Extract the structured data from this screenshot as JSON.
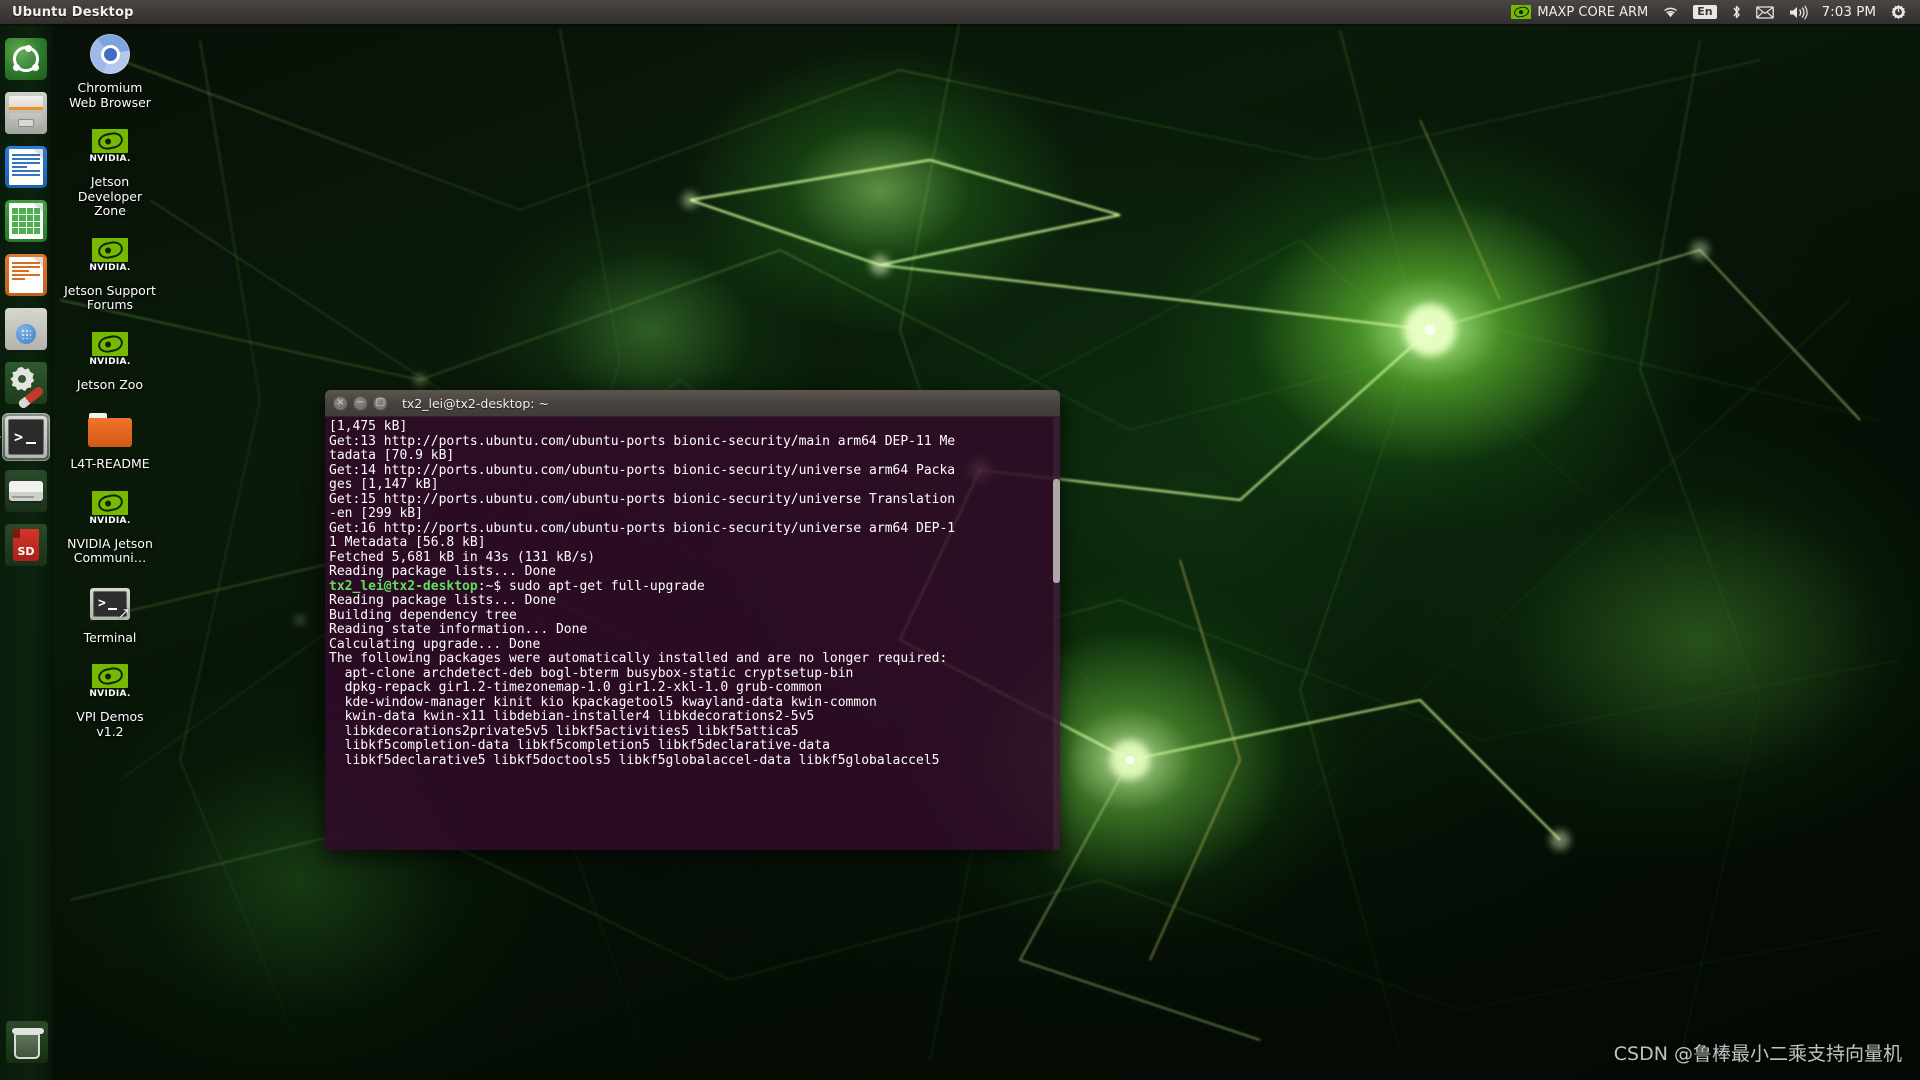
{
  "panel": {
    "title": "Ubuntu Desktop",
    "indicators": {
      "nvidia_logo": "nvidia-logo-icon",
      "nvidia_label": "MAXP CORE ARM",
      "wifi": "wifi-icon",
      "keyboard": "En",
      "bluetooth": "bluetooth-icon",
      "mail": "mail-icon",
      "volume": "volume-icon",
      "time": "7:03 PM",
      "session": "power-gear-icon"
    }
  },
  "launcher": {
    "items": [
      {
        "name": "ubuntu-dash",
        "label": "Ubuntu Dash",
        "icon": "ubuntu-logo-icon"
      },
      {
        "name": "files",
        "label": "Files",
        "icon": "file-cabinet-icon"
      },
      {
        "name": "libreoffice-writer",
        "label": "LibreOffice Writer",
        "icon": "document-icon"
      },
      {
        "name": "libreoffice-calc",
        "label": "LibreOffice Calc",
        "icon": "spreadsheet-icon"
      },
      {
        "name": "libreoffice-impress",
        "label": "LibreOffice Impress",
        "icon": "presentation-icon"
      },
      {
        "name": "ubuntu-software",
        "label": "Ubuntu Software",
        "icon": "shopping-bag-icon"
      },
      {
        "name": "system-settings",
        "label": "System Settings",
        "icon": "gear-wrench-icon"
      },
      {
        "name": "terminal",
        "label": "Terminal",
        "icon": "terminal-icon",
        "running": true
      },
      {
        "name": "disk-drive",
        "label": "Disk Drive",
        "icon": "hard-drive-icon"
      },
      {
        "name": "sd-card",
        "label": "SD Card",
        "icon": "sd-card-icon",
        "badge": "SD"
      },
      {
        "name": "trash",
        "label": "Trash",
        "icon": "trash-icon"
      }
    ]
  },
  "desktop": {
    "icons": [
      {
        "name": "chromium-web-browser",
        "label": "Chromium Web Browser",
        "icon": "chromium-icon"
      },
      {
        "name": "jetson-developer-zone",
        "label": "Jetson Developer Zone",
        "icon": "nvidia-icon",
        "brand": "NVIDIA."
      },
      {
        "name": "jetson-support-forums",
        "label": "Jetson Support Forums",
        "icon": "nvidia-icon",
        "brand": "NVIDIA."
      },
      {
        "name": "jetson-zoo",
        "label": "Jetson Zoo",
        "icon": "nvidia-icon",
        "brand": "NVIDIA."
      },
      {
        "name": "l4t-readme",
        "label": "L4T-README",
        "icon": "folder-icon"
      },
      {
        "name": "nvidia-jetson-community",
        "label": "NVIDIA Jetson Communi…",
        "icon": "nvidia-icon",
        "brand": "NVIDIA."
      },
      {
        "name": "terminal-shortcut",
        "label": "Terminal",
        "icon": "terminal-shortcut-icon"
      },
      {
        "name": "vpi-demos",
        "label": "VPI Demos v1.2",
        "icon": "nvidia-icon",
        "brand": "NVIDIA."
      }
    ]
  },
  "terminal": {
    "title": "tx2_lei@tx2-desktop: ~",
    "buttons": {
      "close": "×",
      "minimize": "−",
      "maximize": "□"
    },
    "prompt_user": "tx2_lei@tx2-desktop",
    "lines": [
      {
        "text": "[1,475 kB]"
      },
      {
        "text": "Get:13 http://ports.ubuntu.com/ubuntu-ports bionic-security/main arm64 DEP-11 Me"
      },
      {
        "text": "tadata [70.9 kB]"
      },
      {
        "text": "Get:14 http://ports.ubuntu.com/ubuntu-ports bionic-security/universe arm64 Packa"
      },
      {
        "text": "ges [1,147 kB]"
      },
      {
        "text": "Get:15 http://ports.ubuntu.com/ubuntu-ports bionic-security/universe Translation"
      },
      {
        "text": "-en [299 kB]"
      },
      {
        "text": "Get:16 http://ports.ubuntu.com/ubuntu-ports bionic-security/universe arm64 DEP-1"
      },
      {
        "text": "1 Metadata [56.8 kB]"
      },
      {
        "text": "Fetched 5,681 kB in 43s (131 kB/s)"
      },
      {
        "text": "Reading package lists... Done"
      },
      {
        "prompt": "tx2_lei@tx2-desktop",
        "text": ":~$ sudo apt-get full-upgrade"
      },
      {
        "text": "Reading package lists... Done"
      },
      {
        "text": "Building dependency tree"
      },
      {
        "text": "Reading state information... Done"
      },
      {
        "text": "Calculating upgrade... Done"
      },
      {
        "text": "The following packages were automatically installed and are no longer required:"
      },
      {
        "text": "  apt-clone archdetect-deb bogl-bterm busybox-static cryptsetup-bin"
      },
      {
        "text": "  dpkg-repack gir1.2-timezonemap-1.0 gir1.2-xkl-1.0 grub-common"
      },
      {
        "text": "  kde-window-manager kinit kio kpackagetool5 kwayland-data kwin-common"
      },
      {
        "text": "  kwin-data kwin-x11 libdebian-installer4 libkdecorations2-5v5"
      },
      {
        "text": "  libkdecorations2private5v5 libkf5activities5 libkf5attica5"
      },
      {
        "text": "  libkf5completion-data libkf5completion5 libkf5declarative-data"
      },
      {
        "text": "  libkf5declarative5 libkf5doctools5 libkf5globalaccel-data libkf5globalaccel5"
      }
    ]
  },
  "watermark": "CSDN @鲁棒最小二乘支持向量机",
  "colors": {
    "nvidia_green": "#76b900",
    "terminal_bg": "#300a28",
    "panel_bg": "#3d3936",
    "prompt_green": "#5fe05f",
    "folder_orange": "#e0661f"
  }
}
